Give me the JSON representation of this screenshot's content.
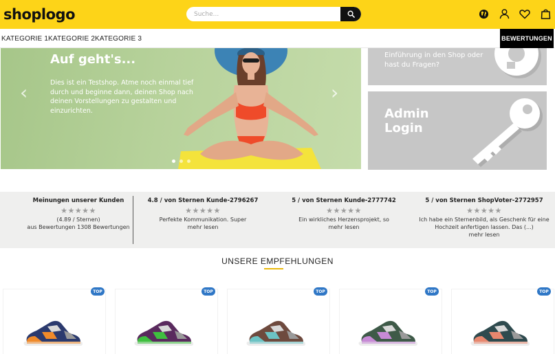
{
  "header": {
    "logo": "shoplogo",
    "search_placeholder": "Suche...",
    "icons": [
      "globe-icon",
      "user-icon",
      "heart-icon",
      "bag-icon"
    ]
  },
  "nav": {
    "items": [
      {
        "label": "KATEGORIE 1"
      },
      {
        "label": "KATEGORIE 2"
      },
      {
        "label": "KATEGORIE 3"
      }
    ],
    "reviews_button": "BEWERTUNGEN"
  },
  "hero": {
    "title": "Auf geht's...",
    "text": "Dies ist ein Testshop. Atme noch einmal tief durch und beginne dann, deinen Shop nach deinen Vorstellungen zu gestalten und einzurichten.",
    "slides": 3,
    "active_slide": 1
  },
  "banners": {
    "top_text_line1": "Einführung in den Shop oder",
    "top_text_line2": "hast du Fragen?",
    "admin_line1": "Admin",
    "admin_line2": "Login"
  },
  "reviews": {
    "summary": {
      "title": "Meinungen unserer Kunden",
      "rating": "(4.89 / Sternen)",
      "count": "aus Bewertungen 1308 Bewertungen",
      "stars": "★★★★★"
    },
    "items": [
      {
        "title": "4.8 / von Sternen Kunde-2796267",
        "stars": "★★★★★",
        "line1": "Perfekte Kommunikation. Super",
        "line2": "",
        "more": "mehr lesen"
      },
      {
        "title": "5 / von Sternen Kunde-2777742",
        "stars": "★★★★★",
        "line1": "Ein wirkliches Herzensprojekt, so",
        "line2": "",
        "more": "mehr lesen"
      },
      {
        "title": "5 / von Sternen ShopVoter-2772957",
        "stars": "★★★★★",
        "line1": "Ich habe ein Sternenbild, als Geschenk für eine",
        "line2": "Hochzeit anfertigen lassen. Das (...)",
        "more": "mehr lesen"
      }
    ]
  },
  "recommendations": {
    "title": "UNSERE EMPFEHLUNGEN",
    "accent": "#e9b80b",
    "products": [
      {
        "badge": "TOP",
        "accent_color": "#f08a2a",
        "body_color": "#2b3a6e"
      },
      {
        "badge": "TOP",
        "accent_color": "#3fbf3f",
        "body_color": "#5a2a5e"
      },
      {
        "badge": "TOP",
        "accent_color": "#6cc3c4",
        "body_color": "#6e4a3e"
      },
      {
        "badge": "TOP",
        "accent_color": "#c78ad6",
        "body_color": "#3e5a48"
      },
      {
        "badge": "TOP",
        "accent_color": "#e8876e",
        "body_color": "#2e4a4e"
      }
    ]
  },
  "colors": {
    "brand_yellow": "#fdd418",
    "badge_blue": "#2f77c6",
    "hero_green": "#b7d29b"
  }
}
